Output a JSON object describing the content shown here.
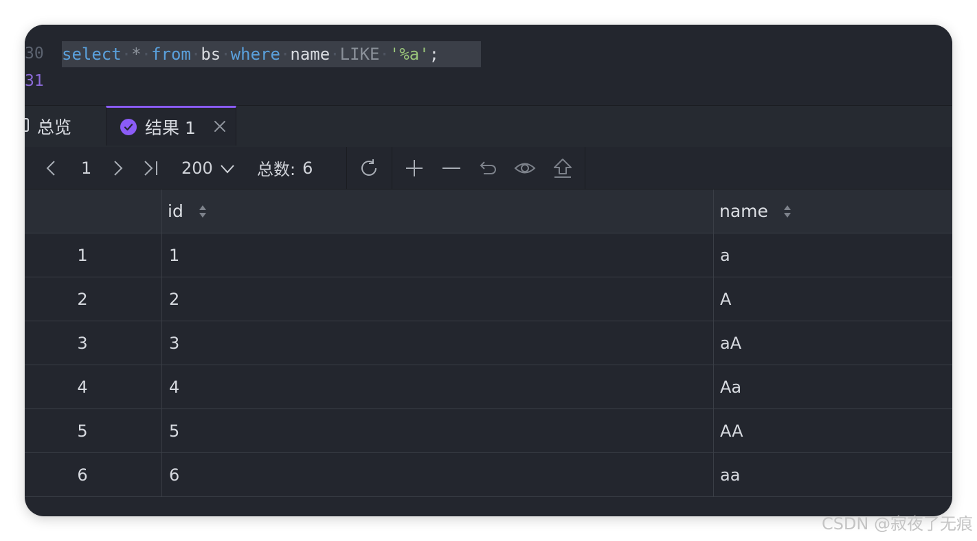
{
  "editor": {
    "line_numbers": [
      "30",
      "31"
    ],
    "code": {
      "kw_select": "select",
      "star": "*",
      "kw_from": "from",
      "table": "bs",
      "kw_where": "where",
      "column": "name",
      "kw_like": "LIKE",
      "pattern": "'%a'",
      "terminator": ";"
    }
  },
  "tabs": {
    "overview": "总览",
    "result": "结果 1"
  },
  "toolbar": {
    "page": "1",
    "page_size": "200",
    "total_label": "总数:",
    "total": "6"
  },
  "grid": {
    "columns": [
      "id",
      "name"
    ],
    "rows": [
      {
        "num": "1",
        "id": "1",
        "name": "a"
      },
      {
        "num": "2",
        "id": "2",
        "name": "A"
      },
      {
        "num": "3",
        "id": "3",
        "name": "aA"
      },
      {
        "num": "4",
        "id": "4",
        "name": "Aa"
      },
      {
        "num": "5",
        "id": "5",
        "name": "AA"
      },
      {
        "num": "6",
        "id": "6",
        "name": "aa"
      }
    ]
  },
  "colors": {
    "accent": "#8b5cf6",
    "background": "#23262e",
    "keyword": "#5aa0dc",
    "string": "#98c379"
  },
  "watermark": "CSDN @寂夜了无痕"
}
